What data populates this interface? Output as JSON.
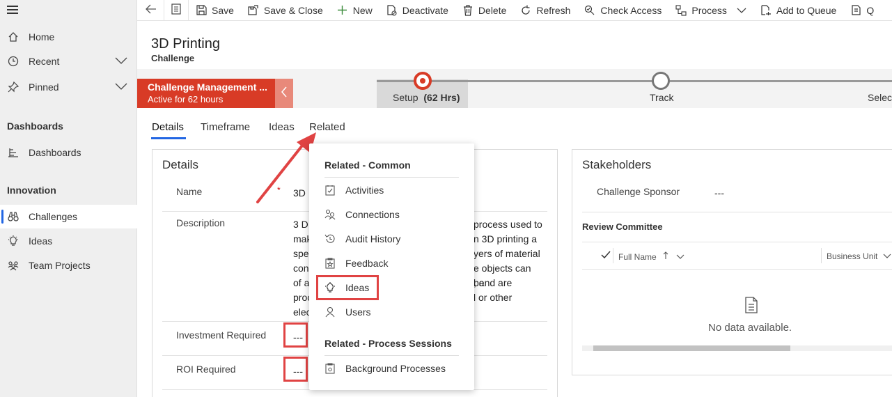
{
  "sidebar": {
    "items": [
      {
        "label": "Home",
        "icon": "home-icon"
      },
      {
        "label": "Recent",
        "icon": "clock-icon"
      },
      {
        "label": "Pinned",
        "icon": "pin-icon"
      }
    ],
    "sections": [
      {
        "title": "Dashboards",
        "items": [
          {
            "label": "Dashboards",
            "icon": "dashboard-icon"
          }
        ]
      },
      {
        "title": "Innovation",
        "items": [
          {
            "label": "Challenges",
            "icon": "binoculars-icon",
            "active": true
          },
          {
            "label": "Ideas",
            "icon": "lightbulb-icon"
          },
          {
            "label": "Team Projects",
            "icon": "team-icon"
          }
        ]
      }
    ]
  },
  "toolbar": {
    "buttons": [
      {
        "label": "Save",
        "icon": "save-icon"
      },
      {
        "label": "Save & Close",
        "icon": "save-close-icon"
      },
      {
        "label": "New",
        "icon": "plus-icon"
      },
      {
        "label": "Deactivate",
        "icon": "deactivate-icon"
      },
      {
        "label": "Delete",
        "icon": "trash-icon"
      },
      {
        "label": "Refresh",
        "icon": "refresh-icon"
      },
      {
        "label": "Check Access",
        "icon": "check-access-icon"
      },
      {
        "label": "Process",
        "icon": "process-icon"
      },
      {
        "label": "Add to Queue",
        "icon": "queue-icon"
      },
      {
        "label": "Q",
        "icon": "query-icon"
      }
    ]
  },
  "record": {
    "title": "3D Printing",
    "entity": "Challenge"
  },
  "process": {
    "flyout_title": "Challenge Management ...",
    "flyout_status": "Active for 62 hours",
    "stages": [
      {
        "label": "Setup",
        "duration": "(62 Hrs)",
        "active": true
      },
      {
        "label": "Track",
        "active": false
      },
      {
        "label": "Select",
        "active": false
      }
    ]
  },
  "tabs": [
    "Details",
    "Timeframe",
    "Ideas",
    "Related"
  ],
  "details": {
    "title": "Details",
    "name_label": "Name",
    "name_value": "3D",
    "description_label": "Description",
    "description_lines": [
      "3 D",
      "mak",
      "spe",
      "con",
      "of a",
      "proc",
      "elec"
    ],
    "description_right_lines": [
      "process used to",
      "n 3D printing a",
      "yers of material",
      "e objects can be",
      ", and are",
      "l or other",
      ""
    ],
    "investment_label": "Investment Required",
    "investment_value": "---",
    "roi_label": "ROI Required",
    "roi_value": "---"
  },
  "stakeholders": {
    "title": "Stakeholders",
    "sponsor_label": "Challenge Sponsor",
    "sponsor_value": "---",
    "committee_title": "Review Committee",
    "col_full_name": "Full Name",
    "col_business_unit": "Business Unit",
    "empty_text": "No data available."
  },
  "related_menu": {
    "common_header": "Related - Common",
    "common_items": [
      {
        "label": "Activities",
        "icon": "activities-icon"
      },
      {
        "label": "Connections",
        "icon": "connections-icon"
      },
      {
        "label": "Audit History",
        "icon": "history-icon"
      },
      {
        "label": "Feedback",
        "icon": "feedback-icon"
      },
      {
        "label": "Ideas",
        "icon": "lightbulb-icon"
      },
      {
        "label": "Users",
        "icon": "user-icon"
      }
    ],
    "process_header": "Related - Process Sessions",
    "process_items": [
      {
        "label": "Background Processes",
        "icon": "background-process-icon"
      }
    ]
  },
  "colors": {
    "accent": "#2266e3",
    "process_active": "#d83b26",
    "highlight_box": "#e04343"
  }
}
